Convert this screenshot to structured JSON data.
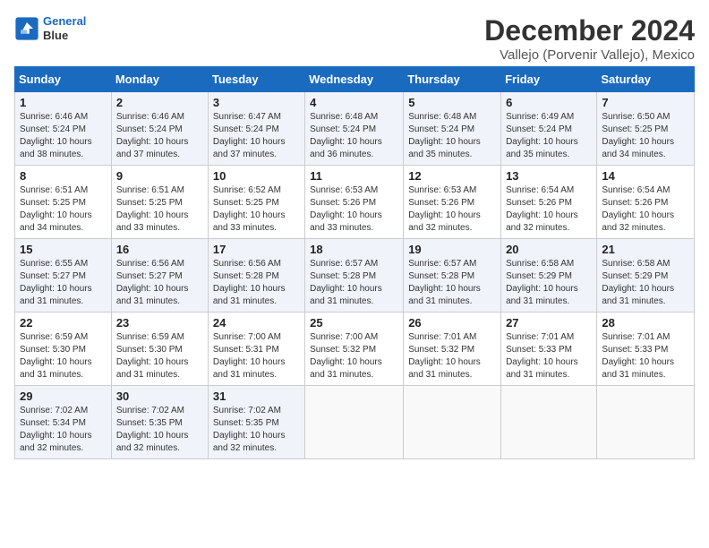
{
  "logo": {
    "line1": "General",
    "line2": "Blue"
  },
  "title": "December 2024",
  "subtitle": "Vallejo (Porvenir Vallejo), Mexico",
  "days_of_week": [
    "Sunday",
    "Monday",
    "Tuesday",
    "Wednesday",
    "Thursday",
    "Friday",
    "Saturday"
  ],
  "weeks": [
    [
      {
        "day": "1",
        "sunrise": "6:46 AM",
        "sunset": "5:24 PM",
        "daylight": "10 hours and 38 minutes."
      },
      {
        "day": "2",
        "sunrise": "6:46 AM",
        "sunset": "5:24 PM",
        "daylight": "10 hours and 37 minutes."
      },
      {
        "day": "3",
        "sunrise": "6:47 AM",
        "sunset": "5:24 PM",
        "daylight": "10 hours and 37 minutes."
      },
      {
        "day": "4",
        "sunrise": "6:48 AM",
        "sunset": "5:24 PM",
        "daylight": "10 hours and 36 minutes."
      },
      {
        "day": "5",
        "sunrise": "6:48 AM",
        "sunset": "5:24 PM",
        "daylight": "10 hours and 35 minutes."
      },
      {
        "day": "6",
        "sunrise": "6:49 AM",
        "sunset": "5:24 PM",
        "daylight": "10 hours and 35 minutes."
      },
      {
        "day": "7",
        "sunrise": "6:50 AM",
        "sunset": "5:25 PM",
        "daylight": "10 hours and 34 minutes."
      }
    ],
    [
      {
        "day": "8",
        "sunrise": "6:51 AM",
        "sunset": "5:25 PM",
        "daylight": "10 hours and 34 minutes."
      },
      {
        "day": "9",
        "sunrise": "6:51 AM",
        "sunset": "5:25 PM",
        "daylight": "10 hours and 33 minutes."
      },
      {
        "day": "10",
        "sunrise": "6:52 AM",
        "sunset": "5:25 PM",
        "daylight": "10 hours and 33 minutes."
      },
      {
        "day": "11",
        "sunrise": "6:53 AM",
        "sunset": "5:26 PM",
        "daylight": "10 hours and 33 minutes."
      },
      {
        "day": "12",
        "sunrise": "6:53 AM",
        "sunset": "5:26 PM",
        "daylight": "10 hours and 32 minutes."
      },
      {
        "day": "13",
        "sunrise": "6:54 AM",
        "sunset": "5:26 PM",
        "daylight": "10 hours and 32 minutes."
      },
      {
        "day": "14",
        "sunrise": "6:54 AM",
        "sunset": "5:26 PM",
        "daylight": "10 hours and 32 minutes."
      }
    ],
    [
      {
        "day": "15",
        "sunrise": "6:55 AM",
        "sunset": "5:27 PM",
        "daylight": "10 hours and 31 minutes."
      },
      {
        "day": "16",
        "sunrise": "6:56 AM",
        "sunset": "5:27 PM",
        "daylight": "10 hours and 31 minutes."
      },
      {
        "day": "17",
        "sunrise": "6:56 AM",
        "sunset": "5:28 PM",
        "daylight": "10 hours and 31 minutes."
      },
      {
        "day": "18",
        "sunrise": "6:57 AM",
        "sunset": "5:28 PM",
        "daylight": "10 hours and 31 minutes."
      },
      {
        "day": "19",
        "sunrise": "6:57 AM",
        "sunset": "5:28 PM",
        "daylight": "10 hours and 31 minutes."
      },
      {
        "day": "20",
        "sunrise": "6:58 AM",
        "sunset": "5:29 PM",
        "daylight": "10 hours and 31 minutes."
      },
      {
        "day": "21",
        "sunrise": "6:58 AM",
        "sunset": "5:29 PM",
        "daylight": "10 hours and 31 minutes."
      }
    ],
    [
      {
        "day": "22",
        "sunrise": "6:59 AM",
        "sunset": "5:30 PM",
        "daylight": "10 hours and 31 minutes."
      },
      {
        "day": "23",
        "sunrise": "6:59 AM",
        "sunset": "5:30 PM",
        "daylight": "10 hours and 31 minutes."
      },
      {
        "day": "24",
        "sunrise": "7:00 AM",
        "sunset": "5:31 PM",
        "daylight": "10 hours and 31 minutes."
      },
      {
        "day": "25",
        "sunrise": "7:00 AM",
        "sunset": "5:32 PM",
        "daylight": "10 hours and 31 minutes."
      },
      {
        "day": "26",
        "sunrise": "7:01 AM",
        "sunset": "5:32 PM",
        "daylight": "10 hours and 31 minutes."
      },
      {
        "day": "27",
        "sunrise": "7:01 AM",
        "sunset": "5:33 PM",
        "daylight": "10 hours and 31 minutes."
      },
      {
        "day": "28",
        "sunrise": "7:01 AM",
        "sunset": "5:33 PM",
        "daylight": "10 hours and 31 minutes."
      }
    ],
    [
      {
        "day": "29",
        "sunrise": "7:02 AM",
        "sunset": "5:34 PM",
        "daylight": "10 hours and 32 minutes."
      },
      {
        "day": "30",
        "sunrise": "7:02 AM",
        "sunset": "5:35 PM",
        "daylight": "10 hours and 32 minutes."
      },
      {
        "day": "31",
        "sunrise": "7:02 AM",
        "sunset": "5:35 PM",
        "daylight": "10 hours and 32 minutes."
      },
      null,
      null,
      null,
      null
    ]
  ]
}
